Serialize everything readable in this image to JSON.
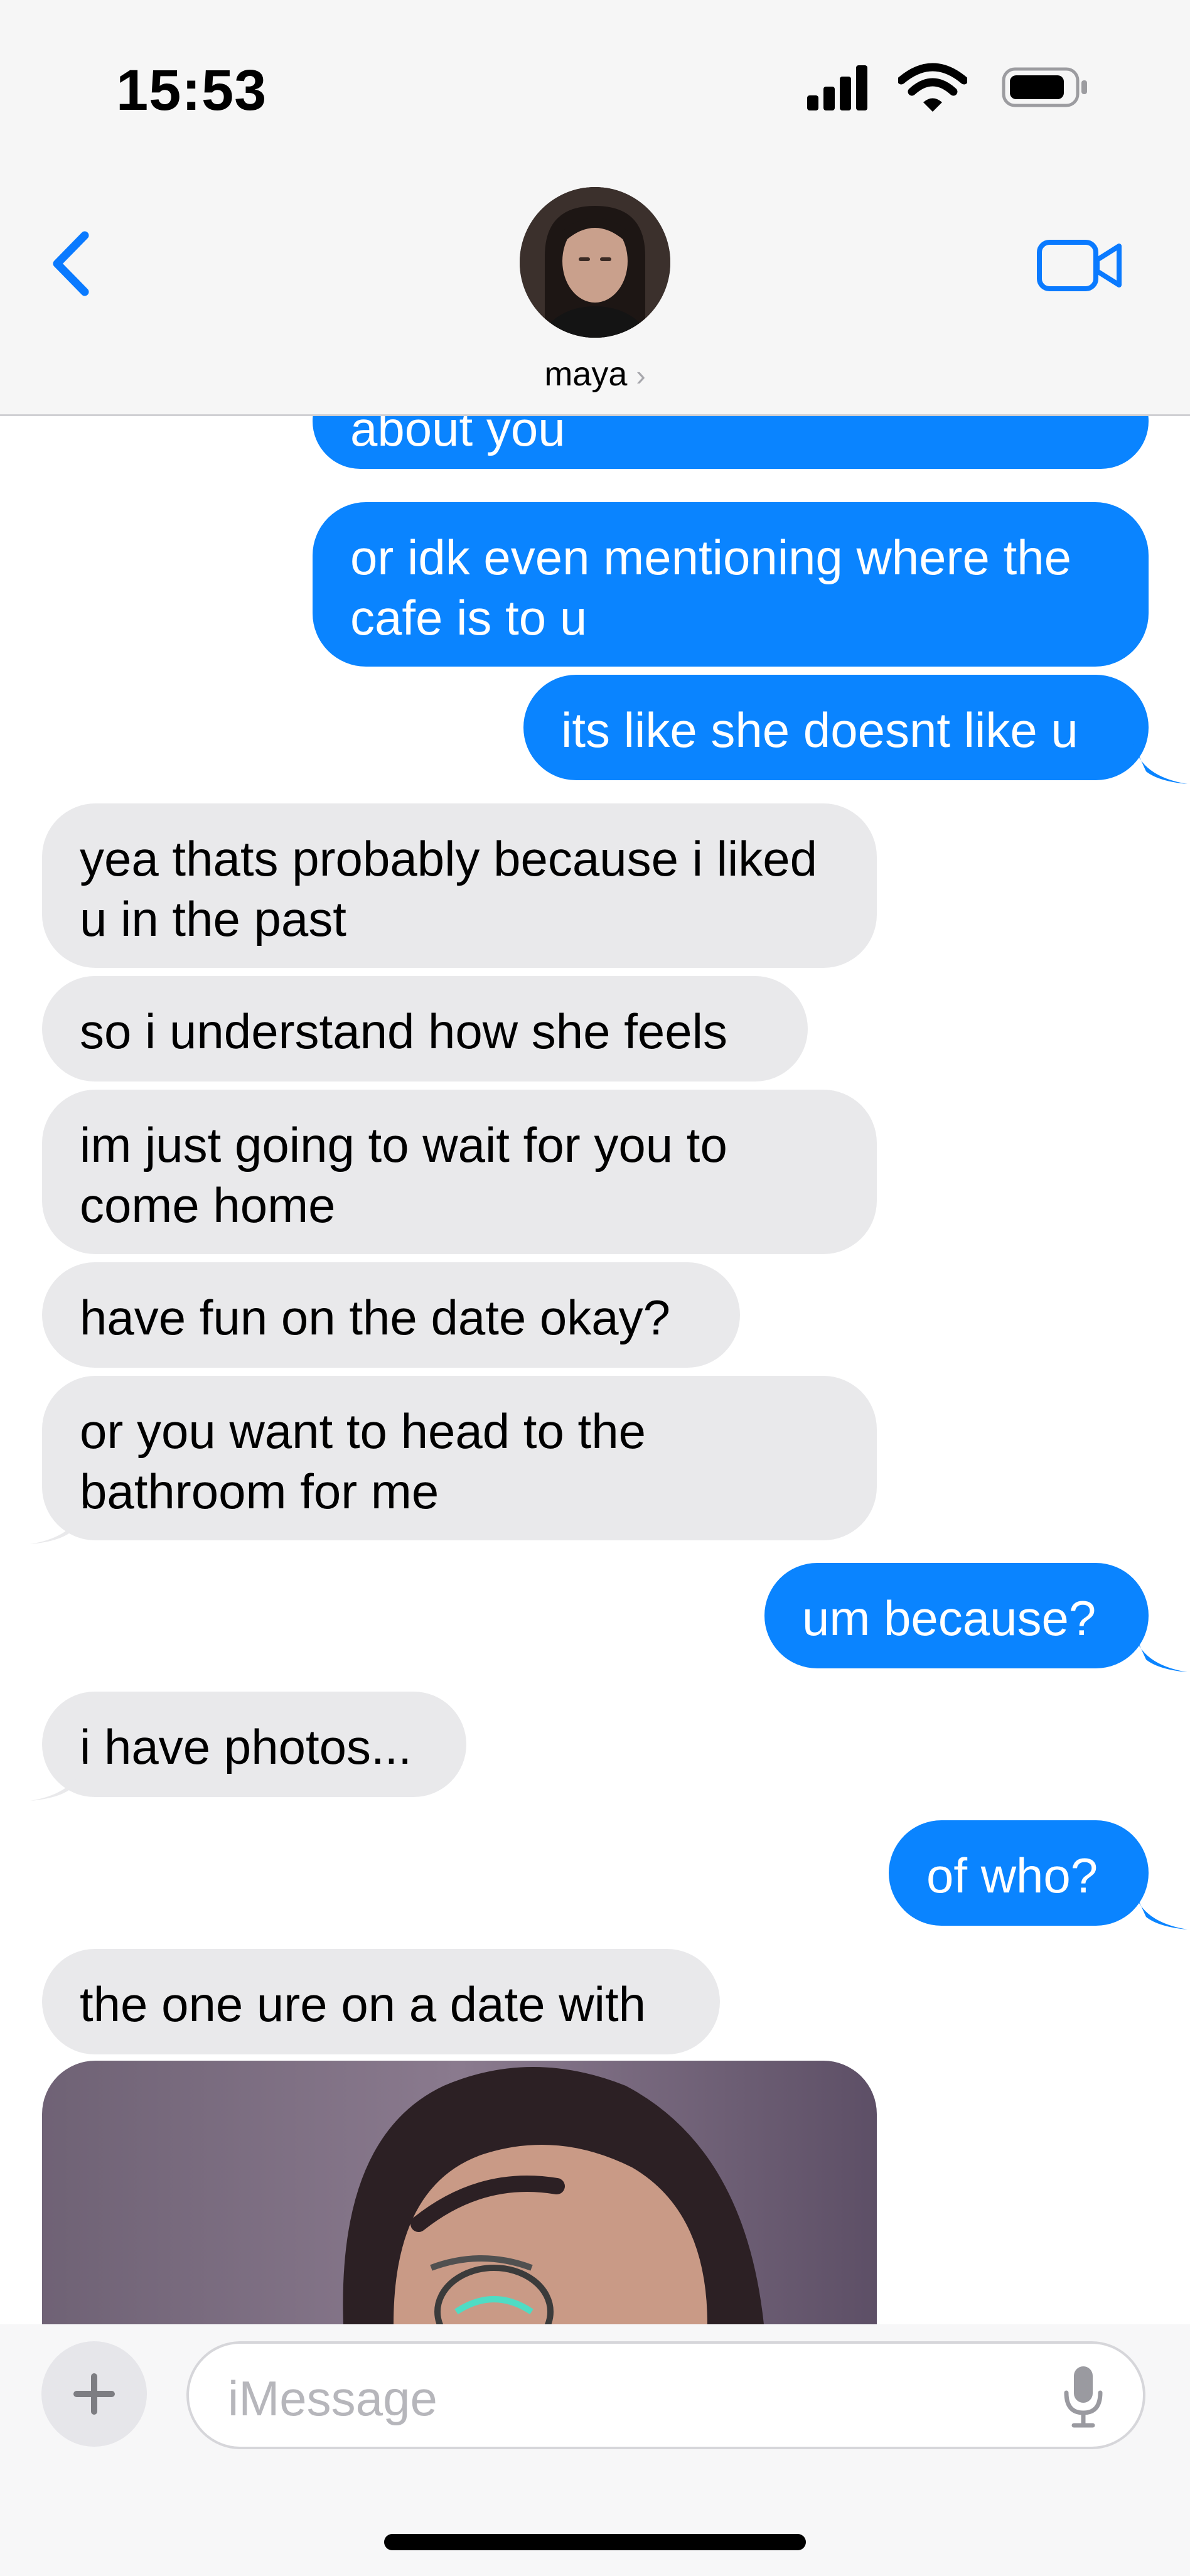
{
  "status_bar": {
    "time": "15:53"
  },
  "header": {
    "contact_name": "maya"
  },
  "messages": [
    {
      "from": "me",
      "text": "about you"
    },
    {
      "from": "me",
      "text": "or idk even mentioning where the cafe is to u"
    },
    {
      "from": "me",
      "text": "its like she doesnt like u"
    },
    {
      "from": "them",
      "text": "yea thats probably because i liked u in the past"
    },
    {
      "from": "them",
      "text": "so i understand how she feels"
    },
    {
      "from": "them",
      "text": "im just going to wait for you to come home"
    },
    {
      "from": "them",
      "text": "have fun on the date okay?"
    },
    {
      "from": "them",
      "text": "or you want to head to the bathroom for me"
    },
    {
      "from": "me",
      "text": "um because?"
    },
    {
      "from": "them",
      "text": "i have photos..."
    },
    {
      "from": "me",
      "text": "of who?"
    },
    {
      "from": "them",
      "text": "the one ure on a date with"
    }
  ],
  "composer": {
    "placeholder": "iMessage"
  },
  "colors": {
    "accent": "#0a84ff",
    "incoming_bubble": "#e9e9eb"
  }
}
